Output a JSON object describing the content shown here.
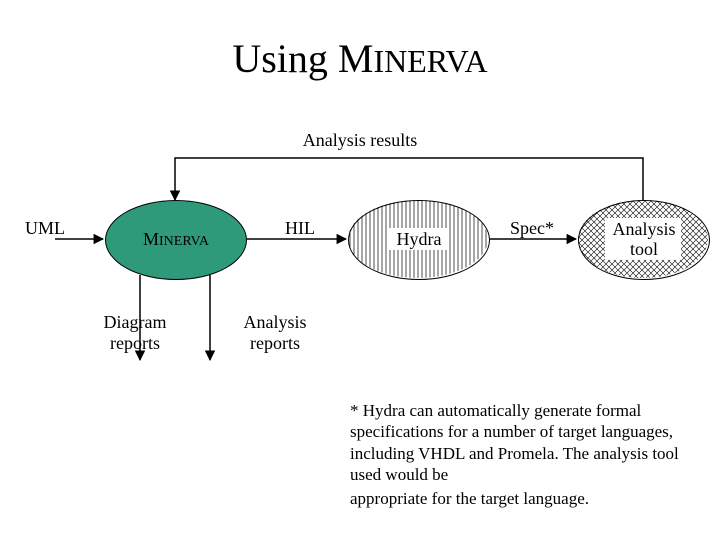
{
  "title": {
    "pre": "Using M",
    "caps": "INERVA"
  },
  "labels": {
    "analysis_results": "Analysis results",
    "uml": "UML",
    "hil": "HIL",
    "spec": "Spec*",
    "diagram_reports": "Diagram\nreports",
    "analysis_reports": "Analysis\nreports"
  },
  "nodes": {
    "minerva": {
      "pre": "M",
      "caps": "INERVA"
    },
    "hydra": "Hydra",
    "analysis_tool": "Analysis\ntool"
  },
  "footnote": "* Hydra can automatically generate formal specifications for a number of target languages, including VHDL and Promela. The analysis tool used would be",
  "footnote2": "appropriate for the target language."
}
